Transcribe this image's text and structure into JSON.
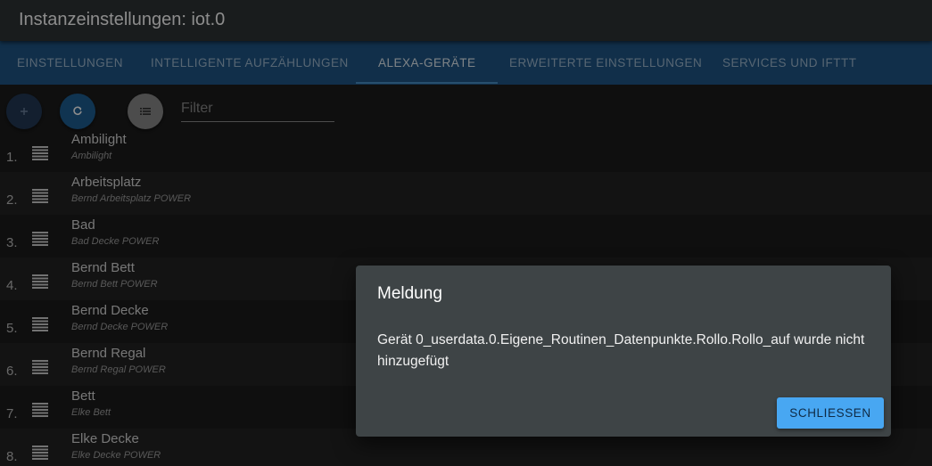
{
  "window": {
    "title": "Instanzeinstellungen: iot.0"
  },
  "tabs": [
    {
      "label": "Einstellungen",
      "active": false
    },
    {
      "label": "Intelligente Aufzählungen",
      "active": false
    },
    {
      "label": "Alexa-Geräte",
      "active": true
    },
    {
      "label": "Erweiterte Einstellungen",
      "active": false
    },
    {
      "label": "Services und IFTTT",
      "active": false
    }
  ],
  "toolbar": {
    "add_icon": "plus-icon",
    "refresh_icon": "refresh-icon",
    "list_icon": "list-icon",
    "filter_placeholder": "Filter"
  },
  "devices": [
    {
      "num": "1.",
      "name": "Ambilight",
      "sub": "Ambilight"
    },
    {
      "num": "2.",
      "name": "Arbeitsplatz",
      "sub": "Bernd Arbeitsplatz POWER"
    },
    {
      "num": "3.",
      "name": "Bad",
      "sub": "Bad Decke POWER"
    },
    {
      "num": "4.",
      "name": "Bernd Bett",
      "sub": "Bernd Bett POWER"
    },
    {
      "num": "5.",
      "name": "Bernd Decke",
      "sub": "Bernd Decke POWER"
    },
    {
      "num": "6.",
      "name": "Bernd Regal",
      "sub": "Bernd Regal POWER"
    },
    {
      "num": "7.",
      "name": "Bett",
      "sub": "Elke Bett"
    },
    {
      "num": "8.",
      "name": "Elke Decke",
      "sub": "Elke Decke POWER"
    }
  ],
  "dialog": {
    "title": "Meldung",
    "message": "Gerät 0_userdata.0.Eigene_Routinen_Datenpunkte.Rollo.Rollo_auf wurde nicht hinzugefügt",
    "close_label": "Schliessen"
  },
  "colors": {
    "titlebar": "#2f3436",
    "tabbar": "#1f5687",
    "accent": "#48a7f2",
    "dialog": "#3e4446"
  }
}
